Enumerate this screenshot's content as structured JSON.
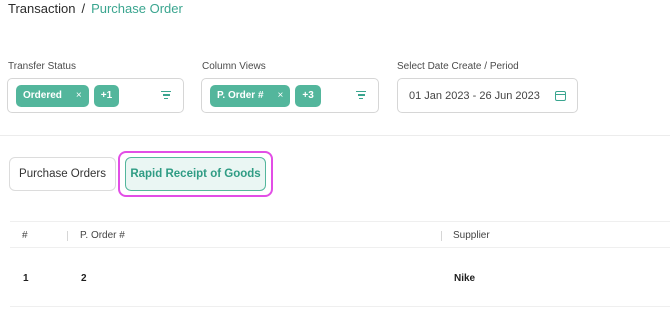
{
  "breadcrumb": {
    "root": "Transaction",
    "separator": "/",
    "current": "Purchase Order"
  },
  "filters": {
    "transfer_status": {
      "label": "Transfer Status",
      "chip": "Ordered",
      "chip_remove": "×",
      "more": "+1"
    },
    "column_views": {
      "label": "Column Views",
      "chip": "P. Order #",
      "chip_remove": "×",
      "more": "+3"
    },
    "date": {
      "label": "Select Date Create / Period",
      "value": "01 Jan 2023 - 26 Jun 2023"
    }
  },
  "tabs": {
    "purchase_orders": "Purchase Orders",
    "rapid_receipt": "Rapid Receipt of Goods"
  },
  "table": {
    "columns": [
      "#",
      "P. Order #",
      "Supplier"
    ],
    "rows": [
      {
        "index": "1",
        "order": "2",
        "supplier": "Nike"
      }
    ]
  },
  "colors": {
    "accent": "#53b69c",
    "accent_text": "#3aa58f",
    "highlight": "#e24ee6"
  },
  "icons": {
    "filter": "filter-lines-icon",
    "calendar": "calendar-icon",
    "remove": "close-icon"
  }
}
